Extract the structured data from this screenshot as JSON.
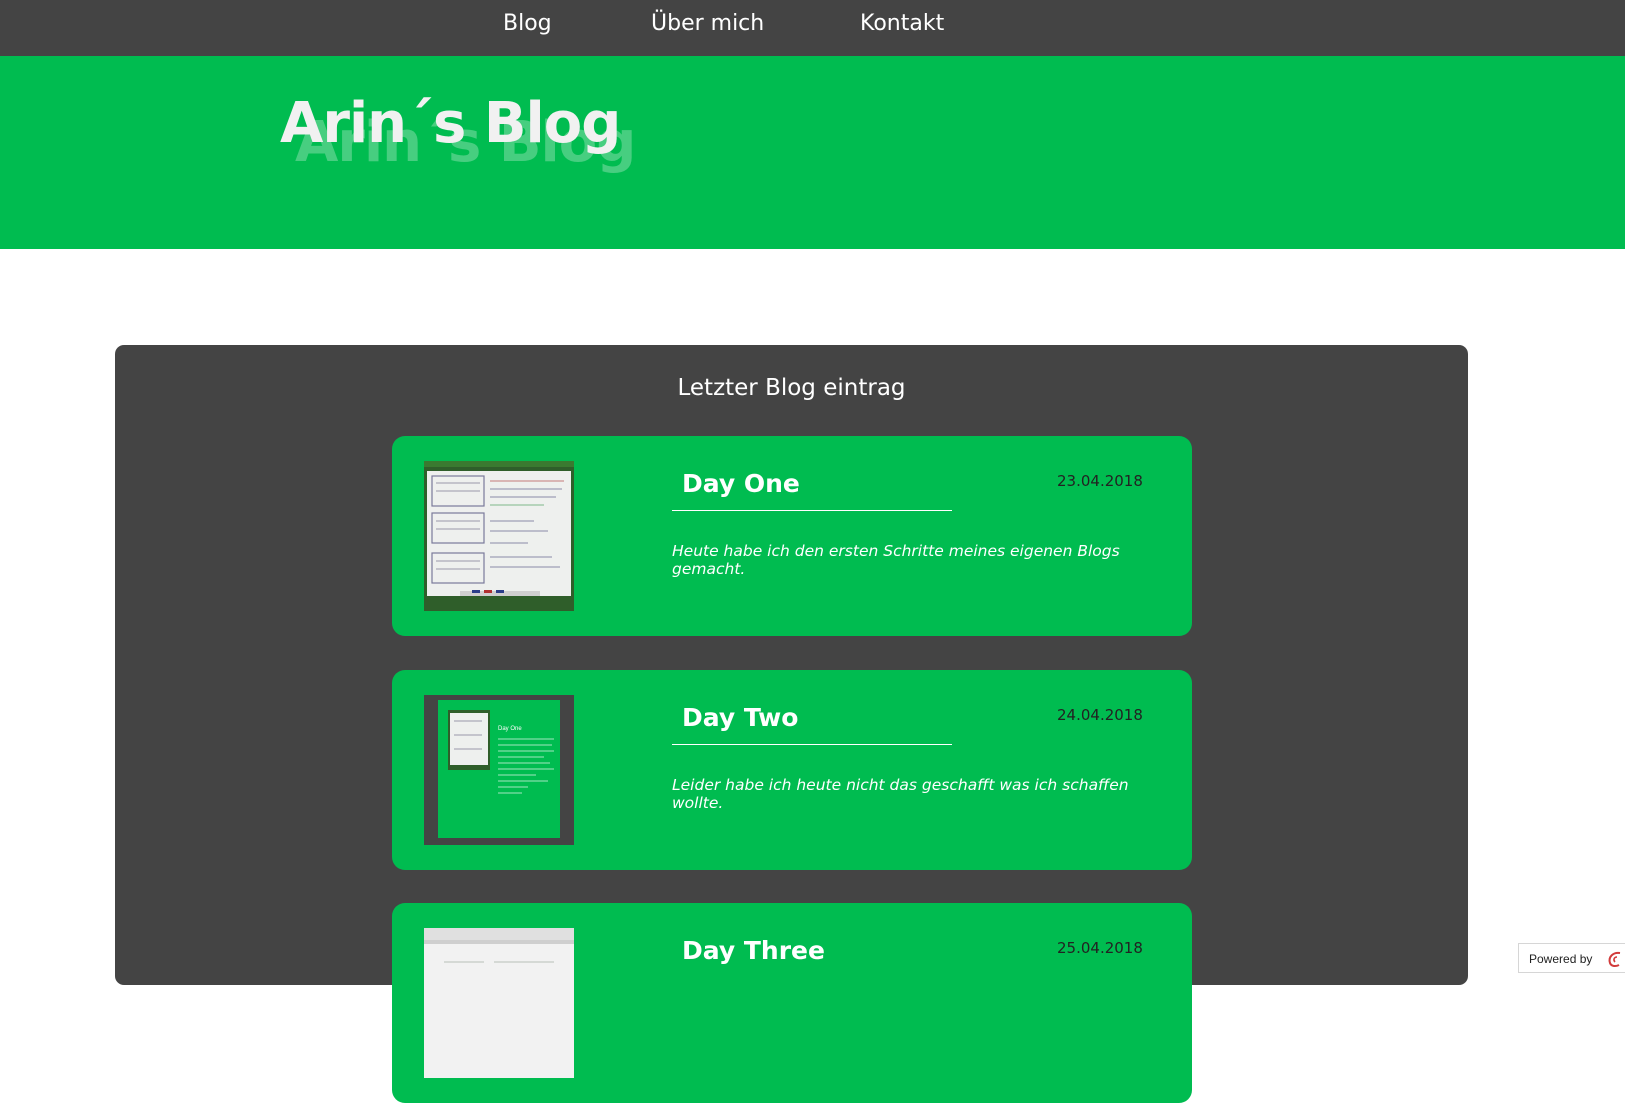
{
  "nav": {
    "items": [
      {
        "label": "Blog"
      },
      {
        "label": "Über mich"
      },
      {
        "label": "Kontakt"
      }
    ]
  },
  "hero": {
    "title": "Arin´s Blog"
  },
  "main": {
    "heading": "Letzter Blog eintrag",
    "posts": [
      {
        "title": "Day One",
        "date": "23.04.2018",
        "excerpt": "Heute habe ich den ersten Schritte meines eigenen Blogs gemacht.",
        "thumbnail": "whiteboard-photo"
      },
      {
        "title": "Day Two",
        "date": "24.04.2018",
        "excerpt": "Leider habe ich heute nicht das geschafft was ich schaffen wollte.",
        "thumbnail": "blog-screenshot",
        "thumbnail_text": "Day One"
      },
      {
        "title": "Day Three",
        "date": "25.04.2018",
        "excerpt": "",
        "thumbnail": "whiteboard-photo"
      }
    ]
  },
  "footer_badge": {
    "label": "Powered by"
  },
  "colors": {
    "nav_bg": "#444444",
    "brand_green": "#00bc50",
    "panel_bg": "#444444",
    "text_light": "#ffffff"
  }
}
